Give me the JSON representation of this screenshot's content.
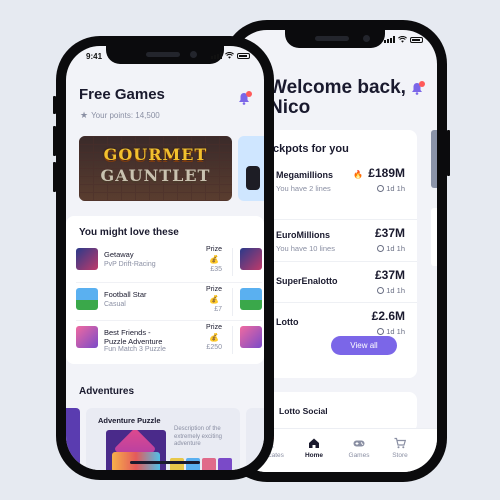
{
  "back_phone": {
    "status_time": "",
    "welcome_line1": "Welcome back,",
    "welcome_line2": "Nico",
    "jackpots_title": "ckpots for you",
    "jackpots": [
      {
        "name": "Megamillions",
        "sub": "You have 2 lines",
        "amount": "£189M",
        "time": "1d 1h",
        "hot": true
      },
      {
        "name": "EuroMillions",
        "sub": "You have 10 lines",
        "amount": "£37M",
        "time": "1d 1h",
        "hot": false
      },
      {
        "name": "SuperEnalotto",
        "sub": "",
        "amount": "£37M",
        "time": "1d 1h",
        "hot": false
      },
      {
        "name": "Lotto",
        "sub": "",
        "amount": "£2.6M",
        "time": "1d 1h",
        "hot": false
      }
    ],
    "view_all": "View all",
    "lotto_social": "Lotto Social",
    "tabs": [
      {
        "label": "Syndicates",
        "icon": "people-icon"
      },
      {
        "label": "Home",
        "icon": "home-icon",
        "active": true
      },
      {
        "label": "Games",
        "icon": "gamepad-icon"
      },
      {
        "label": "Store",
        "icon": "cart-icon"
      }
    ]
  },
  "front_phone": {
    "status_time": "9:41",
    "title": "Free Games",
    "points": "Your points: 14,500",
    "hero_title_line1": "GOURMET",
    "hero_title_line2": "GAUNTLET",
    "love_title": "You might love these",
    "games": [
      {
        "name": "Getaway",
        "genre": "PvP Drift-Racing",
        "prize_label": "Prize",
        "prize": "£35"
      },
      {
        "name": "Football Star",
        "genre": "Casual",
        "prize_label": "Prize",
        "prize": "£7"
      },
      {
        "name": "Best Friends - Puzzle Adventure",
        "genre": "Fun Match 3 Puzzle",
        "prize_label": "Prize",
        "prize": "£250"
      }
    ],
    "adventures_title": "Adventures",
    "adventure_card": {
      "title": "Adventure Puzzle",
      "desc": "Description of the extremely exciting adventure"
    }
  },
  "colors": {
    "accent": "#7b66e8",
    "background": "#e6eaf1",
    "badge": "#ff5a5a"
  }
}
